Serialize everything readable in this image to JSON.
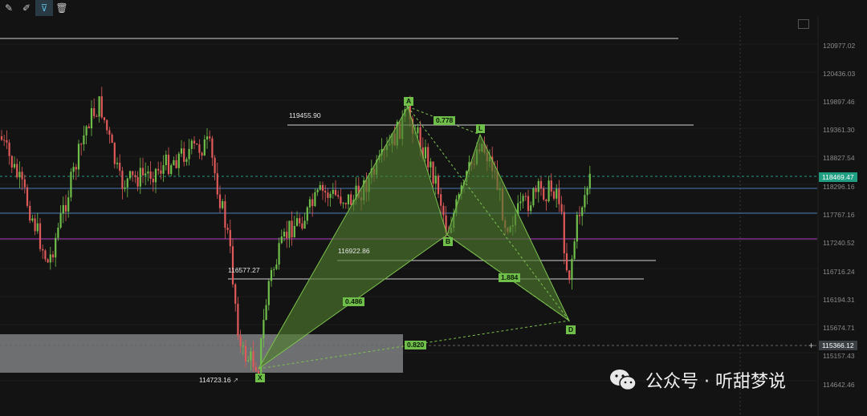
{
  "toolbar": {
    "items": [
      {
        "name": "edit-text-icon",
        "glyph": "✎",
        "active": false
      },
      {
        "name": "brush-icon",
        "glyph": "✐",
        "active": false
      },
      {
        "name": "filter-icon",
        "glyph": "⊽",
        "active": true
      },
      {
        "name": "trash-icon",
        "glyph": "🗑",
        "active": false
      }
    ]
  },
  "price_axis": {
    "labels": [
      "120977.02",
      "120436.03",
      "119897.46",
      "119361.30",
      "118827.54",
      "118296.16",
      "117767.16",
      "117240.52",
      "116716.24",
      "116194.31",
      "115674.71",
      "115157.43",
      "114642.46"
    ],
    "current_price": "118469.47",
    "crosshair_price": "115366.12"
  },
  "pattern": {
    "points": {
      "X": "X",
      "A": "A",
      "B": "B",
      "C": "L",
      "D": "D"
    },
    "ratios": {
      "xb": "0.486",
      "ac": "0.778",
      "bd": "1.884",
      "xd": "0.820"
    },
    "levels": {
      "a_level": "119455.90",
      "b_level": "116922.86",
      "x_ref": "116577.27",
      "x_low": "114723.16"
    }
  },
  "watermark": {
    "text": "公众号 · 听甜梦说"
  },
  "colors": {
    "background": "#131313",
    "bull": "#6fbf4a",
    "bear": "#e05a5a",
    "pattern_fill": "#4f7a2e",
    "blue_line": "#4a78b5",
    "purple_line": "#b040c0",
    "current_price_tag": "#1f9e82"
  }
}
